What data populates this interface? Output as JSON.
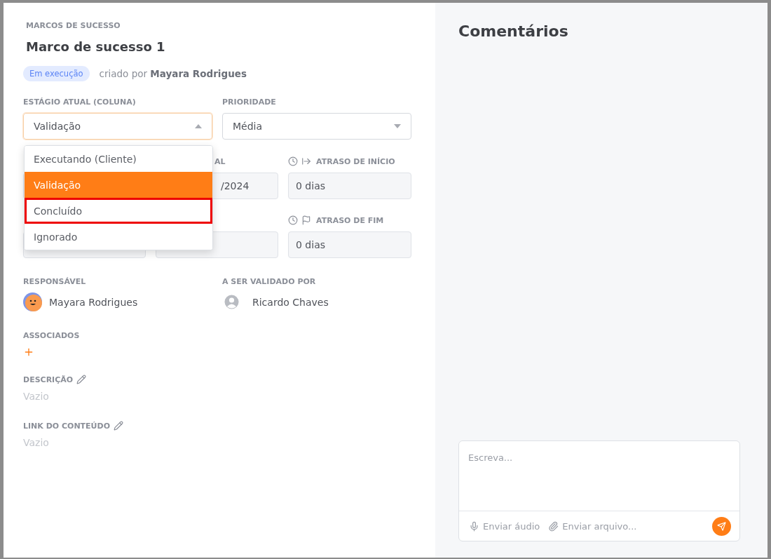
{
  "header": {
    "section": "MARCOS DE SUCESSO",
    "title": "Marco de sucesso 1",
    "status": "Em execução",
    "created_by": "criado por **Mayara Rodrigues**"
  },
  "stage": {
    "label": "ESTÁGIO ATUAL (COLUNA)",
    "value": "Validação",
    "expanded": true,
    "options": [
      {
        "label": "Executando (Cliente)",
        "selected": false,
        "highlighted": false
      },
      {
        "label": "Validação",
        "selected": true,
        "highlighted": false
      },
      {
        "label": "Concluído",
        "selected": false,
        "highlighted": true
      },
      {
        "label": "Ignorado",
        "selected": false,
        "highlighted": false
      }
    ]
  },
  "priority": {
    "label": "PRIORIDADE",
    "value": "Média",
    "expanded": false
  },
  "schedule": [
    [
      {
        "kind": "covered"
      },
      {
        "kind": "partial",
        "label": "AL",
        "value": "/2024"
      },
      {
        "kind": "start-delay",
        "label": "ATRASO DE INÍCIO",
        "value": "0 dias"
      }
    ],
    [
      {
        "kind": "covered"
      },
      {
        "kind": "partial"
      },
      {
        "kind": "end-delay",
        "label": "ATRASO DE FIM",
        "value": "0 dias"
      }
    ]
  ],
  "people": [
    {
      "label": "RESPONSÁVEL",
      "name": "Mayara Rodrigues",
      "kind": "cartoon"
    },
    {
      "label": "A SER VALIDADO POR",
      "name": "Ricardo Chaves",
      "kind": "generic"
    }
  ],
  "associates": {
    "label": "ASSOCIADOS"
  },
  "text_fields": [
    {
      "label": "DESCRIÇÃO",
      "value": "Vazio"
    },
    {
      "label": "LINK DO CONTEÚDO",
      "value": "Vazio"
    }
  ],
  "comments": {
    "title": "Comentários",
    "composer": {
      "placeholder": "Escreva...",
      "actions": [
        {
          "kind": "audio",
          "label": "Enviar áudio"
        },
        {
          "kind": "file",
          "label": "Enviar arquivo..."
        }
      ]
    }
  }
}
